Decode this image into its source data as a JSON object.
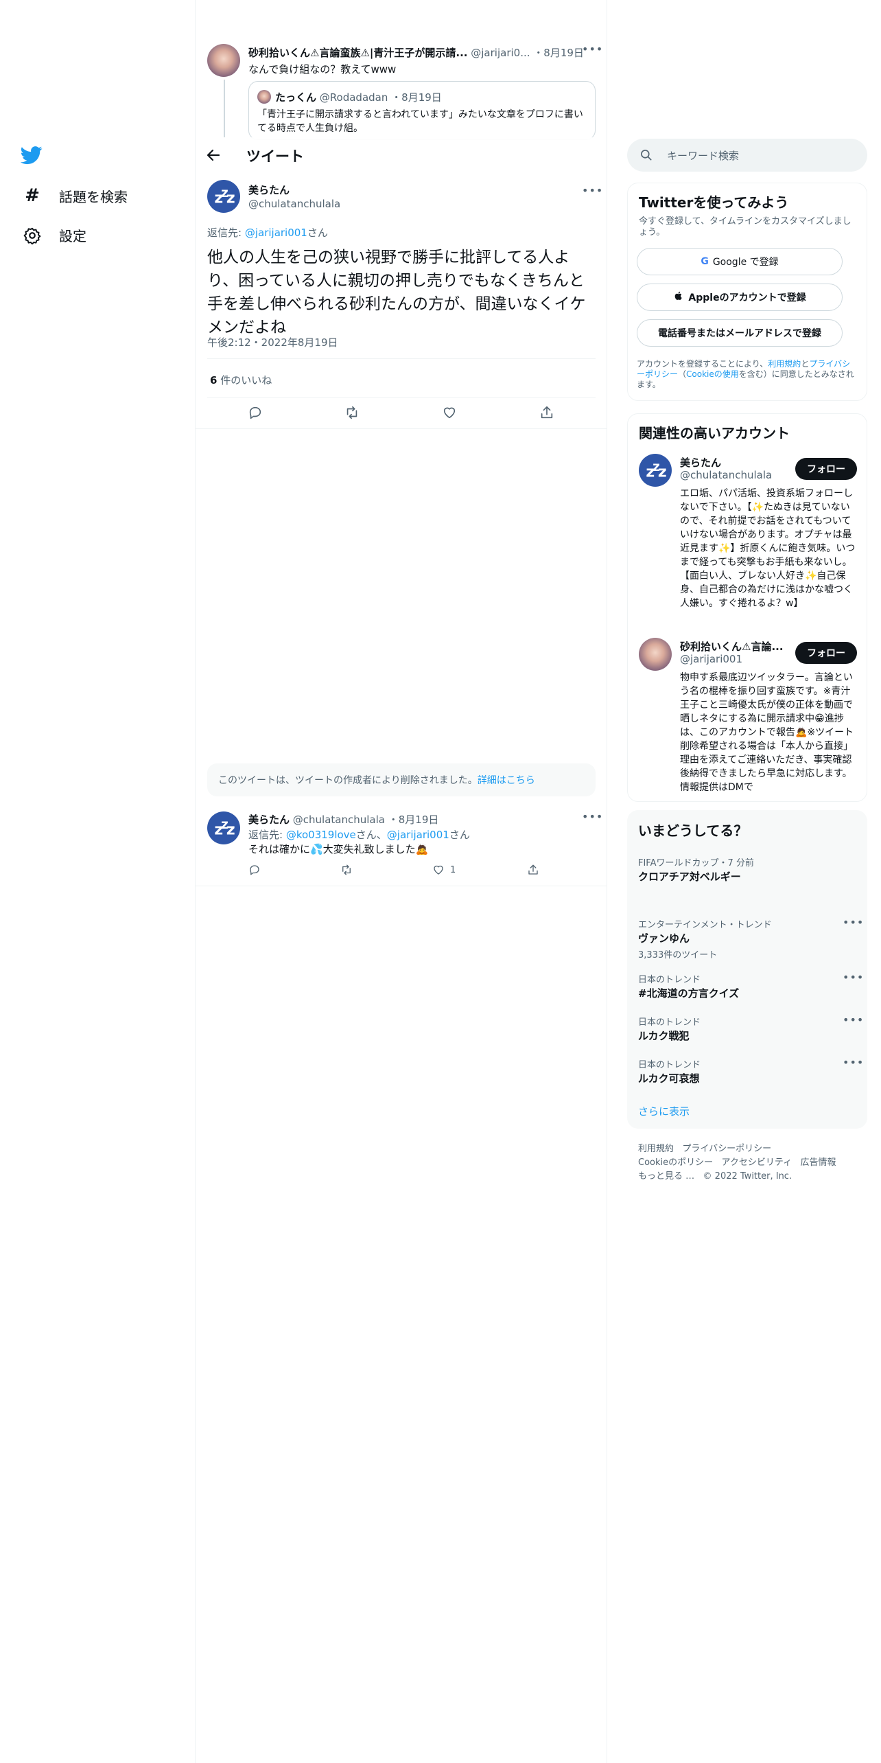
{
  "colors": {
    "brand": "#1d9bf0",
    "text": "#0f1419",
    "muted": "#536471",
    "border": "#eff3f4"
  },
  "nav": {
    "logo": "twitter-bird-icon",
    "explore": "話題を検索",
    "settings": "設定"
  },
  "header": {
    "title": "ツイート",
    "back": "arrow-left-icon"
  },
  "parent_tweet": {
    "name": "砂利拾いくん⚠言論蛮族⚠|青汁王子が開示請...",
    "handle": "@jarijari0...",
    "date": "・8月19日",
    "text": "なんで負け組なの？教えてwww",
    "quote": {
      "name": "たっくん",
      "handle": "@Rodadadan",
      "date": "・8月19日",
      "text": "「青汁王子に開示請求すると言われています」みたいな文章をプロフに書いてる時点で人生負け組。"
    }
  },
  "main_tweet": {
    "name": "美らたん",
    "handle": "@chulatanchulala",
    "reply_prefix": "返信先: ",
    "reply_to": "@jarijari001",
    "reply_suffix": "さん",
    "text": "他人の人生を己の狭い視野で勝手に批評してる人より、困っている人に親切の押し売りでもなくきちんと手を差し伸べられる砂利たんの方が、間違いなくイケメンだよね",
    "timestamp": "午後2:12・2022年8月19日",
    "likes_count": "6",
    "likes_label": "件のいいね"
  },
  "deleted_notice": {
    "text": "このツイートは、ツイートの作成者により削除されました。",
    "link": "詳細はこちら"
  },
  "reply_tweet": {
    "name": "美らたん",
    "handle": "@chulatanchulala",
    "date": "・8月19日",
    "reply_prefix": "返信先: ",
    "reply_to1": "@ko0319love",
    "reply_mid": "さん、",
    "reply_to2": "@jarijari001",
    "reply_suffix": "さん",
    "text": "それは確かに💦大変失礼致しました🙇",
    "like_count": "1"
  },
  "search": {
    "placeholder": "キーワード検索"
  },
  "signup": {
    "title": "Twitterを使ってみよう",
    "subtitle": "今すぐ登録して、タイムラインをカスタマイズしましょう。",
    "google": "Google で登録",
    "apple": "Appleのアカウントで登録",
    "phone": "電話番号またはメールアドレスで登録",
    "terms_1": "アカウントを登録することにより、",
    "terms_link1": "利用規約",
    "terms_2": "と",
    "terms_link2": "プライバシーポリシー",
    "terms_3": "（",
    "terms_link3": "Cookieの使用",
    "terms_4": "を含む）に同意したとみなされます。"
  },
  "related": {
    "title": "関連性の高いアカウント",
    "follow": "フォロー",
    "accounts": [
      {
        "name": "美らたん",
        "handle": "@chulatanchulala",
        "bio": "エロ垢、パパ活垢、投資系垢フォローしないで下さい。【✨たぬきは見ていないので、それ前提でお話をされてもついていけない場合があります。オプチャは最近見ます✨】折原くんに飽き気味。いつまで経っても突撃もお手紙も来ないし。【面白い人、ブレない人好き✨自己保身、自己都合の為だけに浅はかな嘘つく人嫌い。すぐ捲れるよ？w】"
      },
      {
        "name": "砂利拾いくん⚠言論...",
        "handle": "@jarijari001",
        "bio": "物申す系最底辺ツイッタラー。言論という名の棍棒を振り回す蛮族です。※青汁王子こと三崎優太氏が僕の正体を動画で晒しネタにする為に開示請求中😁進捗は、このアカウントで報告🙇※ツイート削除希望される場合は「本人から直接」理由を添えてご連絡いただき、事実確認後納得できましたら早急に対応します。情報提供はDMで"
      }
    ]
  },
  "trends": {
    "title": "いまどうしてる？",
    "items": [
      {
        "category": "FIFAワールドカップ・7 分前",
        "name": "クロアチア対ベルギー",
        "count": ""
      },
      {
        "category": "エンターテインメント・トレンド",
        "name": "ヴァンゆん",
        "count": "3,333件のツイート"
      },
      {
        "category": "日本のトレンド",
        "name": "#北海道の方言クイズ",
        "count": ""
      },
      {
        "category": "日本のトレンド",
        "name": "ルカク戦犯",
        "count": ""
      },
      {
        "category": "日本のトレンド",
        "name": "ルカク可哀想",
        "count": ""
      }
    ],
    "show_more": "さらに表示"
  },
  "footer": {
    "terms": "利用規約",
    "privacy": "プライバシーポリシー",
    "cookie": "Cookieのポリシー",
    "accessibility": "アクセシビリティ",
    "ads": "広告情報",
    "more": "もっと見る …",
    "copyright": "© 2022 Twitter, Inc."
  }
}
